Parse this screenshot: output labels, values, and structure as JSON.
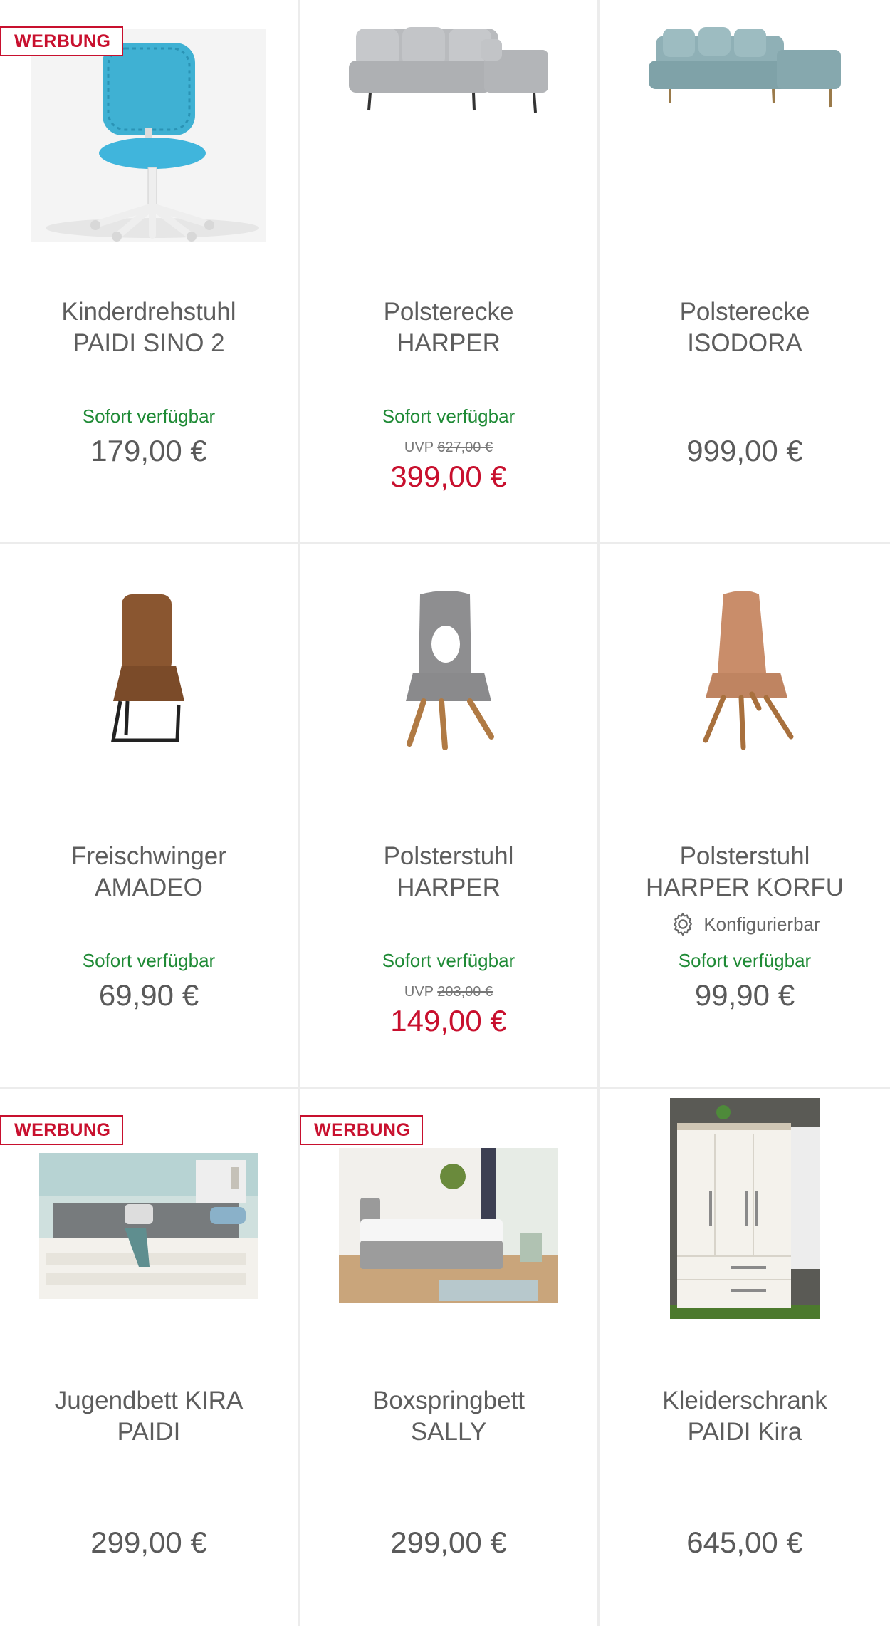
{
  "badge_label": "WERBUNG",
  "products": [
    {
      "title_1": "Kinderdrehstuhl",
      "title_2": "PAIDI SINO 2",
      "availability": "Sofort verfügbar",
      "uvp_label": "",
      "uvp_price": "",
      "price": "179,00 €",
      "sale": false,
      "ad": true,
      "configurable": ""
    },
    {
      "title_1": "Polsterecke",
      "title_2": "HARPER",
      "availability": "Sofort verfügbar",
      "uvp_label": "UVP",
      "uvp_price": "627,00 €",
      "price": "399,00 €",
      "sale": true,
      "ad": false,
      "configurable": ""
    },
    {
      "title_1": "Polsterecke",
      "title_2": "ISODORA",
      "availability": "",
      "uvp_label": "",
      "uvp_price": "",
      "price": "999,00 €",
      "sale": false,
      "ad": false,
      "configurable": ""
    },
    {
      "title_1": "Freischwinger",
      "title_2": "AMADEO",
      "availability": "Sofort verfügbar",
      "uvp_label": "",
      "uvp_price": "",
      "price": "69,90 €",
      "sale": false,
      "ad": false,
      "configurable": ""
    },
    {
      "title_1": "Polsterstuhl",
      "title_2": "HARPER",
      "availability": "Sofort verfügbar",
      "uvp_label": "UVP",
      "uvp_price": "203,00 €",
      "price": "149,00 €",
      "sale": true,
      "ad": false,
      "configurable": ""
    },
    {
      "title_1": "Polsterstuhl",
      "title_2": "HARPER KORFU",
      "availability": "Sofort verfügbar",
      "uvp_label": "",
      "uvp_price": "",
      "price": "99,90 €",
      "sale": false,
      "ad": false,
      "configurable": "Konfigurierbar"
    },
    {
      "title_1": "Jugendbett KIRA",
      "title_2": "PAIDI",
      "availability": "",
      "uvp_label": "",
      "uvp_price": "",
      "price": "299,00 €",
      "sale": false,
      "ad": true,
      "configurable": ""
    },
    {
      "title_1": "Boxspringbett",
      "title_2": "SALLY",
      "availability": "",
      "uvp_label": "",
      "uvp_price": "",
      "price": "299,00 €",
      "sale": false,
      "ad": true,
      "configurable": ""
    },
    {
      "title_1": "Kleiderschrank",
      "title_2": "PAIDI Kira",
      "availability": "",
      "uvp_label": "",
      "uvp_price": "",
      "price": "645,00 €",
      "sale": false,
      "ad": false,
      "configurable": ""
    }
  ],
  "colors": {
    "sale_red": "#c8102e",
    "available_green": "#1e8a35",
    "text_gray": "#5a5a5a",
    "divider": "#ececec"
  }
}
